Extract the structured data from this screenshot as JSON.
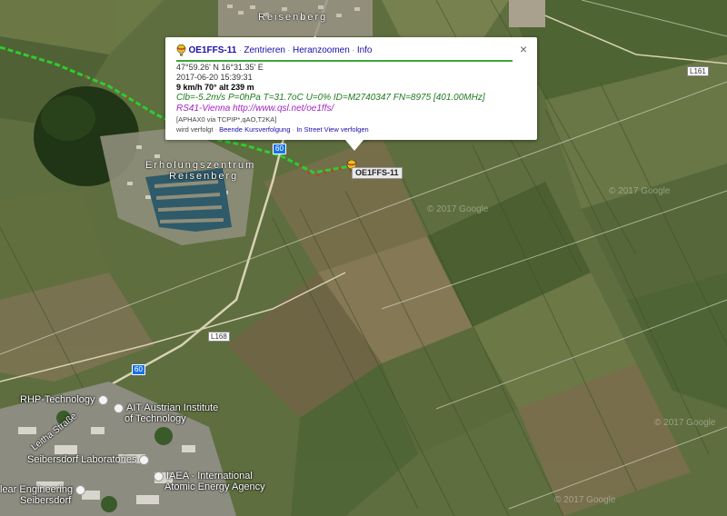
{
  "places": {
    "reisenberg": "Reisenberg",
    "erholung_1": "Erholungszentrum",
    "erholung_2": "Reisenberg",
    "rhp": "RHP-Technology",
    "ait_1": "AIT Austrian Institute",
    "ait_2": "of Technology",
    "seibersdorf_labs": "Seibersdorf Laboratories",
    "iaea_1": "IAEA - International",
    "iaea_2": "Atomic Energy Agency",
    "nuclear_1": "lear Engineering",
    "nuclear_2": "Seibersdorf",
    "street": "Leitha Straße"
  },
  "roads": {
    "shield_60_top": "60",
    "shield_60_bottom": "60",
    "l168": "L168",
    "l161": "L161"
  },
  "watermark": "© 2017 Google",
  "marker": {
    "label": "OE1FFS-11",
    "icon": "balloon-icon"
  },
  "popup": {
    "callsign": "OE1FFS-11",
    "sep": "·",
    "link_center": "Zentrieren",
    "link_zoom": "Heranzoomen",
    "link_info": "Info",
    "close": "×",
    "position": "47°59.26' N 16°31.35' E",
    "timestamp": "2017-06-20 15:39:31",
    "motion": "9 km/h 70° alt 239 m",
    "comment": "Clb=-5.2m/s P=0hPa T=31.7oC U=0% ID=M2740347 FN=8975 [401.00MHz]",
    "station_name": "RS41-Vienna",
    "station_url": "http://www.qsl.net/oe1ffs/",
    "path": "[APHAX0 via TCPIP*,qAO,T2KA]",
    "tracking_text": "wird verfolgt",
    "link_stop_tracking": "Beende Kursverfolgung",
    "link_streetview": "In Street View verfolgen"
  },
  "colors": {
    "track": "#2ecc2e",
    "track_dots": "#c0392b",
    "hr": "#3aa83a"
  }
}
